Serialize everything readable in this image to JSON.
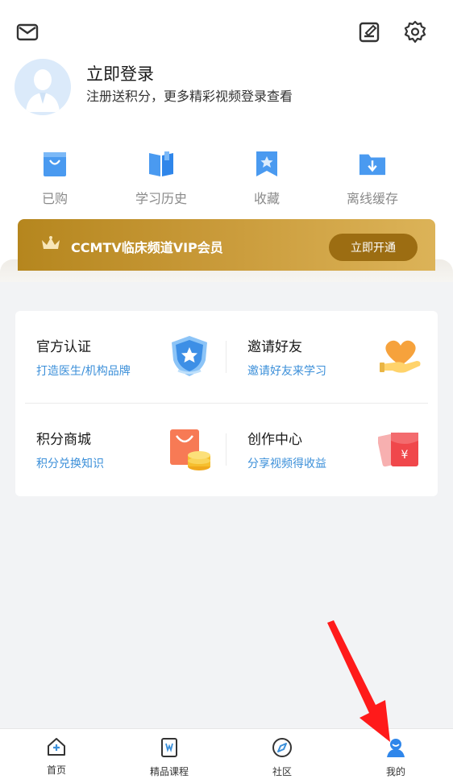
{
  "header": {
    "message_icon": "mail-icon",
    "edit_icon": "edit-note-icon",
    "settings_icon": "gear-icon"
  },
  "profile": {
    "title": "立即登录",
    "subtitle": "注册送积分，更多精彩视频登录查看"
  },
  "quick_actions": [
    {
      "label": "已购",
      "icon": "shopping-bag-icon"
    },
    {
      "label": "学习历史",
      "icon": "book-icon"
    },
    {
      "label": "收藏",
      "icon": "bookmark-star-icon"
    },
    {
      "label": "离线缓存",
      "icon": "download-folder-icon"
    }
  ],
  "vip": {
    "text": "CCMTV临床频道VIP会员",
    "button": "立即开通"
  },
  "services": [
    {
      "title": "官方认证",
      "subtitle": "打造医生/机构品牌",
      "icon": "shield-star-icon"
    },
    {
      "title": "邀请好友",
      "subtitle": "邀请好友来学习",
      "icon": "heart-hand-icon"
    },
    {
      "title": "积分商城",
      "subtitle": "积分兑换知识",
      "icon": "bag-coins-icon"
    },
    {
      "title": "创作中心",
      "subtitle": "分享视频得收益",
      "icon": "red-envelope-icon"
    }
  ],
  "tabbar": [
    {
      "label": "首页",
      "icon": "home-icon"
    },
    {
      "label": "精品课程",
      "icon": "course-icon"
    },
    {
      "label": "社区",
      "icon": "compass-icon"
    },
    {
      "label": "我的",
      "icon": "user-icon",
      "active": true
    }
  ],
  "colors": {
    "accent_blue": "#3b8fd9",
    "vip_gold": "#c89938",
    "arrow_red": "#ff1a1a"
  }
}
